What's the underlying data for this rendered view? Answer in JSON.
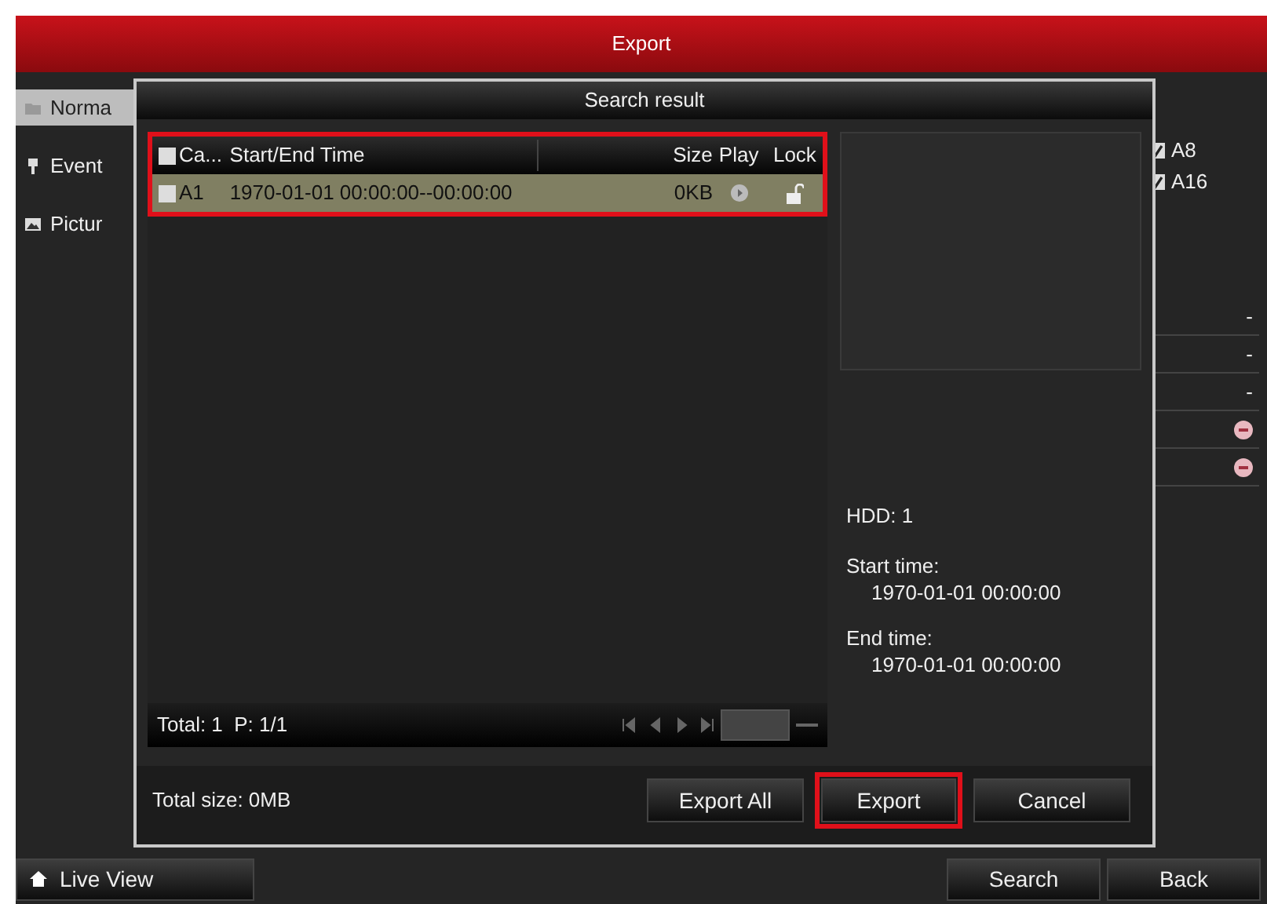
{
  "window": {
    "title": "Export"
  },
  "sidebar": {
    "items": [
      {
        "label": "Norma",
        "selected": true,
        "kind": "folder"
      },
      {
        "label": "Event",
        "selected": false,
        "kind": "pin"
      },
      {
        "label": "Pictur",
        "selected": false,
        "kind": "image"
      }
    ]
  },
  "background_panel": {
    "channels": [
      {
        "label": "A8",
        "checked": true
      },
      {
        "label": "A16",
        "checked": true
      }
    ],
    "rows": [
      {
        "kind": "dash",
        "value": "-"
      },
      {
        "kind": "dash",
        "value": "-"
      },
      {
        "kind": "dash",
        "value": "-"
      },
      {
        "kind": "remove"
      },
      {
        "kind": "remove"
      }
    ]
  },
  "dialog": {
    "title": "Search result",
    "table": {
      "annotated": true,
      "select_all_checked": false,
      "columns": [
        "Ca...",
        "Start/End Time",
        "Size",
        "Play",
        "Lock"
      ],
      "rows": [
        {
          "checked": false,
          "selected": true,
          "camera": "A1",
          "time": "1970-01-01 00:00:00--00:00:00",
          "size": "0KB",
          "locked": false
        }
      ]
    },
    "pager": {
      "summary": "Total: 1  P: 1/1"
    },
    "details": {
      "hdd": "HDD: 1",
      "start_label": "Start time:",
      "start_value": "1970-01-01 00:00:00",
      "end_label": "End time:",
      "end_value": "1970-01-01 00:00:00"
    },
    "total_size": "Total size: 0MB",
    "buttons": [
      {
        "label": "Export All",
        "annotated": false
      },
      {
        "label": "Export",
        "annotated": true
      },
      {
        "label": "Cancel",
        "annotated": false
      }
    ]
  },
  "footer": {
    "live_view": "Live View",
    "buttons": [
      "Search",
      "Back"
    ]
  }
}
